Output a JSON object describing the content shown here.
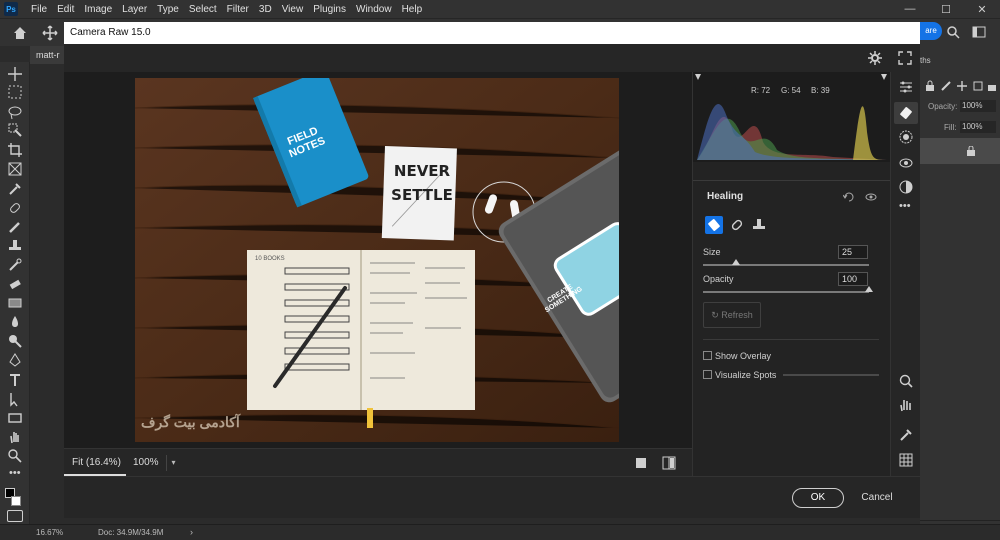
{
  "menubar": {
    "logo": "Ps",
    "items": [
      "File",
      "Edit",
      "Image",
      "Layer",
      "Type",
      "Select",
      "Filter",
      "3D",
      "View",
      "Plugins",
      "Window",
      "Help"
    ],
    "window_controls": [
      "—",
      "☐",
      "✕"
    ]
  },
  "optionsbar": {
    "share_label": "are"
  },
  "document_tab": {
    "label": "matt-r"
  },
  "camera_raw": {
    "title": "Camera Raw 15.0",
    "histogram": {
      "r": "R: 72",
      "g": "G: 54",
      "b": "B: 39"
    },
    "panel_title": "Healing",
    "size_label": "Size",
    "size_value": "25",
    "size_level": 0.2,
    "opacity_label": "Opacity",
    "opacity_value": "100",
    "opacity_level": 1.0,
    "refresh_label": "Refresh",
    "show_overlay_label": "Show Overlay",
    "visualize_spots_label": "Visualize Spots",
    "zoom_fit_label": "Fit (16.4%)",
    "zoom_100_label": "100%",
    "ok_label": "OK",
    "cancel_label": "Cancel"
  },
  "photo": {
    "notebook_label": "FIELD NOTES",
    "card_line1": "NEVER",
    "card_line2": "SETTLE",
    "sticker_label": "CREATE SOMETHING",
    "notebook_heading": "10 BOOKS",
    "watermark": "آکادمی بیت گرف"
  },
  "ps_panels": {
    "tab_label": "ths",
    "opacity_label": "Opacity:",
    "opacity_value": "100%",
    "fill_label": "Fill:",
    "fill_value": "100%"
  },
  "statusbar": {
    "zoom": "16.67%",
    "doc": "Doc: 34.9M/34.9M"
  },
  "colors": {
    "accent": "#1473e6",
    "panel": "#232323",
    "wood": "#4a2c18"
  }
}
